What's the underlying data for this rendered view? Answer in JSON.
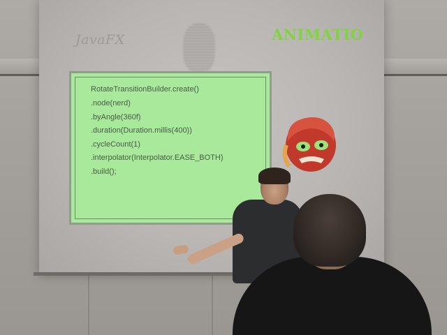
{
  "slide": {
    "brand": "JavaFX",
    "title": "ANIMATION",
    "code_lines": [
      "RotateTransitionBuilder.create()",
      ".node(nerd)",
      ".byAngle(360f)",
      ".duration(Duration.millis(400))",
      ".cycleCount(1)",
      ".interpolator(Interpolator.EASE_BOTH)",
      ".build();"
    ]
  },
  "colors": {
    "title_green": "#7fd43f",
    "code_box_bg": "#a8e99b",
    "screen": "#bebbb9"
  }
}
